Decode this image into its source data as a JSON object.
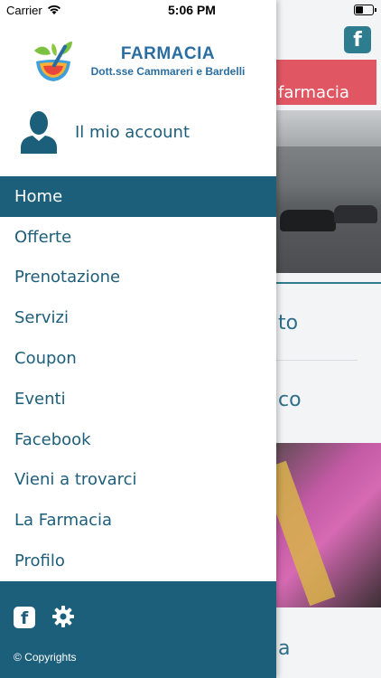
{
  "status_bar": {
    "carrier": "Carrier",
    "time": "5:06 PM"
  },
  "brand": {
    "name": "FARMACIA",
    "subtitle": "Dott.sse Cammareri e Bardelli"
  },
  "account": {
    "label": "Il mio account"
  },
  "menu": {
    "items": [
      {
        "label": "Home",
        "active": true
      },
      {
        "label": "Offerte"
      },
      {
        "label": "Prenotazione"
      },
      {
        "label": "Servizi"
      },
      {
        "label": "Coupon"
      },
      {
        "label": "Eventi"
      },
      {
        "label": "Facebook"
      },
      {
        "label": "Vieni a trovarci"
      },
      {
        "label": "La Farmacia"
      },
      {
        "label": "Profilo"
      }
    ]
  },
  "footer": {
    "copyright": "© Copyrights"
  },
  "background_page": {
    "banner_text": "farmacia",
    "item_1": "to",
    "item_2": "co",
    "item_3": "a"
  },
  "colors": {
    "primary": "#1c5f7b",
    "accent_red": "#e05763",
    "text": "#1d5e7a"
  },
  "icons": [
    "wifi-icon",
    "battery-icon",
    "pharmacy-logo",
    "user-avatar-icon",
    "facebook-icon",
    "gear-icon"
  ]
}
